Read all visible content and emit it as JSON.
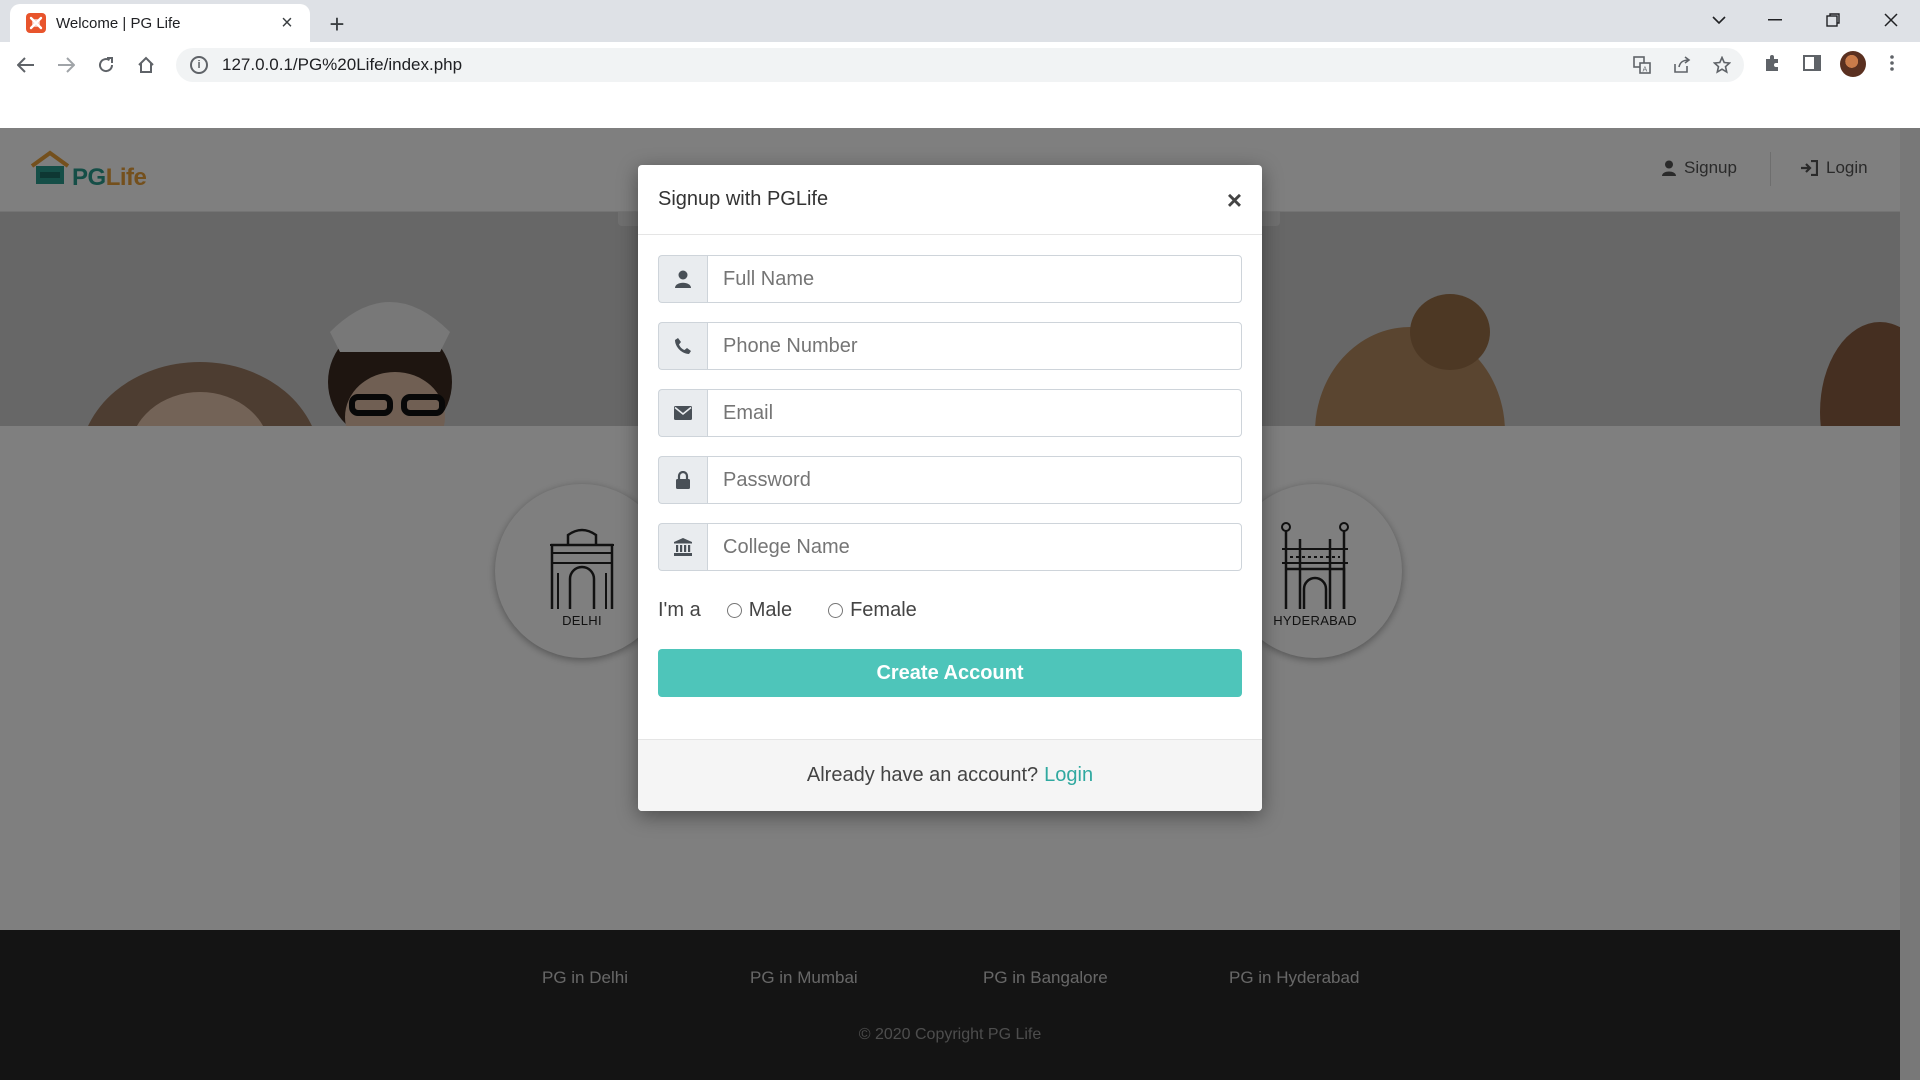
{
  "browser": {
    "tab_title": "Welcome | PG Life",
    "url": "127.0.0.1/PG%20Life/index.php",
    "icons": [
      "back-icon",
      "forward-icon",
      "reload-icon",
      "home-icon",
      "info-icon",
      "translate-icon",
      "share-icon",
      "star-icon",
      "extensions-icon",
      "sidepanel-icon",
      "profile-avatar",
      "menu-icon"
    ]
  },
  "header": {
    "logo_pg": "PG",
    "logo_life": "Life",
    "signup_label": "Signup",
    "login_label": "Login"
  },
  "cities": [
    {
      "name": "DELHI"
    },
    {
      "name": "HYDERABAD"
    }
  ],
  "footer": {
    "links": [
      "PG in Delhi",
      "PG in Mumbai",
      "PG in Bangalore",
      "PG in Hyderabad"
    ],
    "copyright": "© 2020 Copyright PG Life"
  },
  "modal": {
    "title": "Signup with PGLife",
    "close": "×",
    "fields": {
      "full_name": "Full Name",
      "phone": "Phone Number",
      "email": "Email",
      "password": "Password",
      "college": "College Name"
    },
    "gender_label": "I'm a",
    "gender_options": [
      "Male",
      "Female"
    ],
    "submit_label": "Create Account",
    "footer_text": "Already have an account?",
    "footer_link": "Login"
  },
  "colors": {
    "accent": "#4ec5ba",
    "link": "#30a9a0",
    "footer_bg": "#282828"
  }
}
